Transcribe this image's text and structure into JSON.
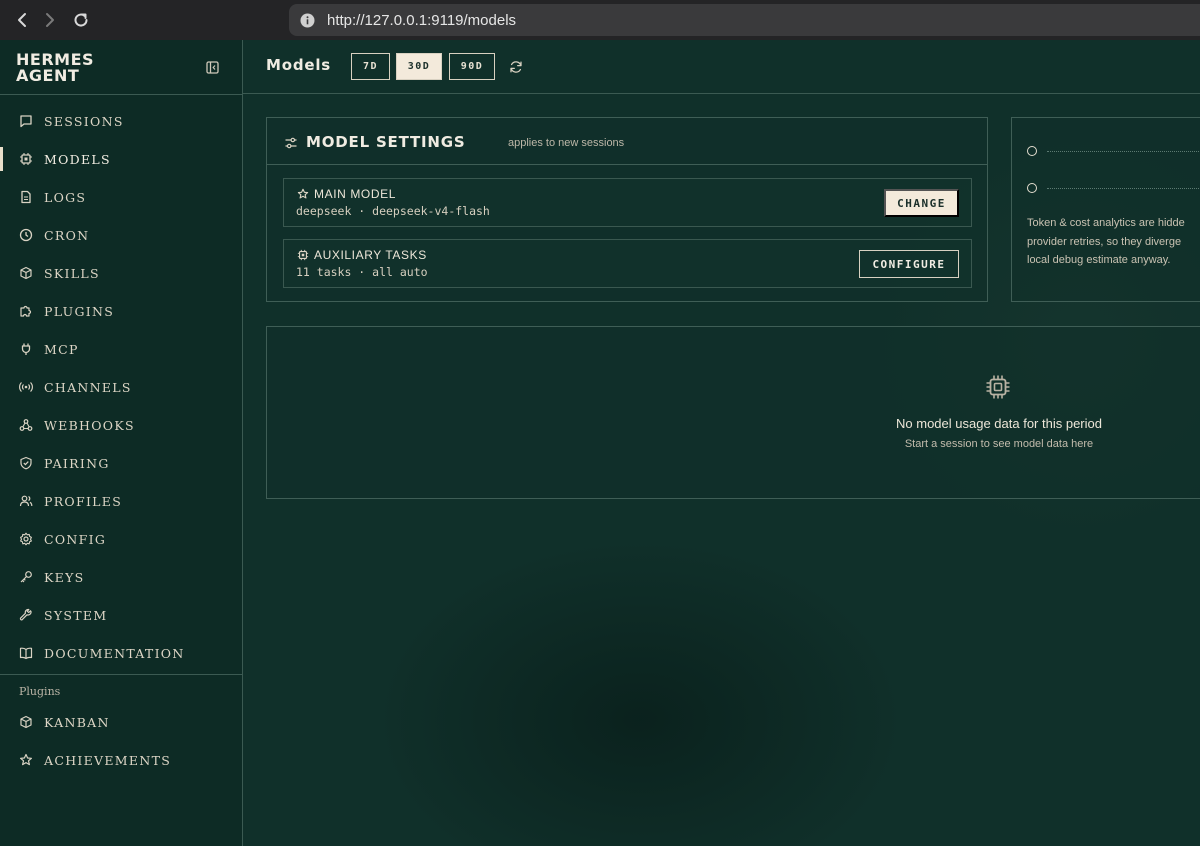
{
  "browser": {
    "url": "http://127.0.0.1:9119/models"
  },
  "brand": {
    "line1": "HERMES",
    "line2": "AGENT"
  },
  "sidebar": {
    "items": [
      {
        "label": "SESSIONS",
        "icon": "chat-bubble-icon"
      },
      {
        "label": "MODELS",
        "icon": "chip-icon",
        "active": true
      },
      {
        "label": "LOGS",
        "icon": "document-icon"
      },
      {
        "label": "CRON",
        "icon": "clock-icon"
      },
      {
        "label": "SKILLS",
        "icon": "cube-icon"
      },
      {
        "label": "PLUGINS",
        "icon": "puzzle-icon"
      },
      {
        "label": "MCP",
        "icon": "plug-icon"
      },
      {
        "label": "CHANNELS",
        "icon": "broadcast-icon"
      },
      {
        "label": "WEBHOOKS",
        "icon": "webhook-icon"
      },
      {
        "label": "PAIRING",
        "icon": "shield-check-icon"
      },
      {
        "label": "PROFILES",
        "icon": "users-icon"
      },
      {
        "label": "CONFIG",
        "icon": "gear-icon"
      },
      {
        "label": "KEYS",
        "icon": "key-icon"
      },
      {
        "label": "SYSTEM",
        "icon": "wrench-icon"
      },
      {
        "label": "DOCUMENTATION",
        "icon": "book-icon"
      }
    ],
    "plugins_heading": "Plugins",
    "plugins": [
      {
        "label": "KANBAN",
        "icon": "cube-icon"
      },
      {
        "label": "ACHIEVEMENTS",
        "icon": "star-icon"
      }
    ]
  },
  "header": {
    "title": "Models",
    "ranges": [
      "7D",
      "30D",
      "90D"
    ],
    "active_range": "30D"
  },
  "model_settings": {
    "title": "MODEL SETTINGS",
    "subtitle": "applies to new sessions",
    "main_model": {
      "label": "MAIN MODEL",
      "value": "deepseek · deepseek-v4-flash",
      "button": "CHANGE"
    },
    "auxiliary": {
      "label": "AUXILIARY TASKS",
      "value": "11 tasks · all auto",
      "button": "CONFIGURE"
    }
  },
  "analytics": {
    "note_lines": [
      "Token & cost analytics are hidde",
      "provider retries, so they diverge",
      "local debug estimate anyway."
    ]
  },
  "empty_state": {
    "title": "No model usage data for this period",
    "subtitle": "Start a session to see model data here"
  },
  "colors": {
    "background": "#10302a",
    "accent_cream": "#f3eadb",
    "border": "#3f5e56"
  }
}
